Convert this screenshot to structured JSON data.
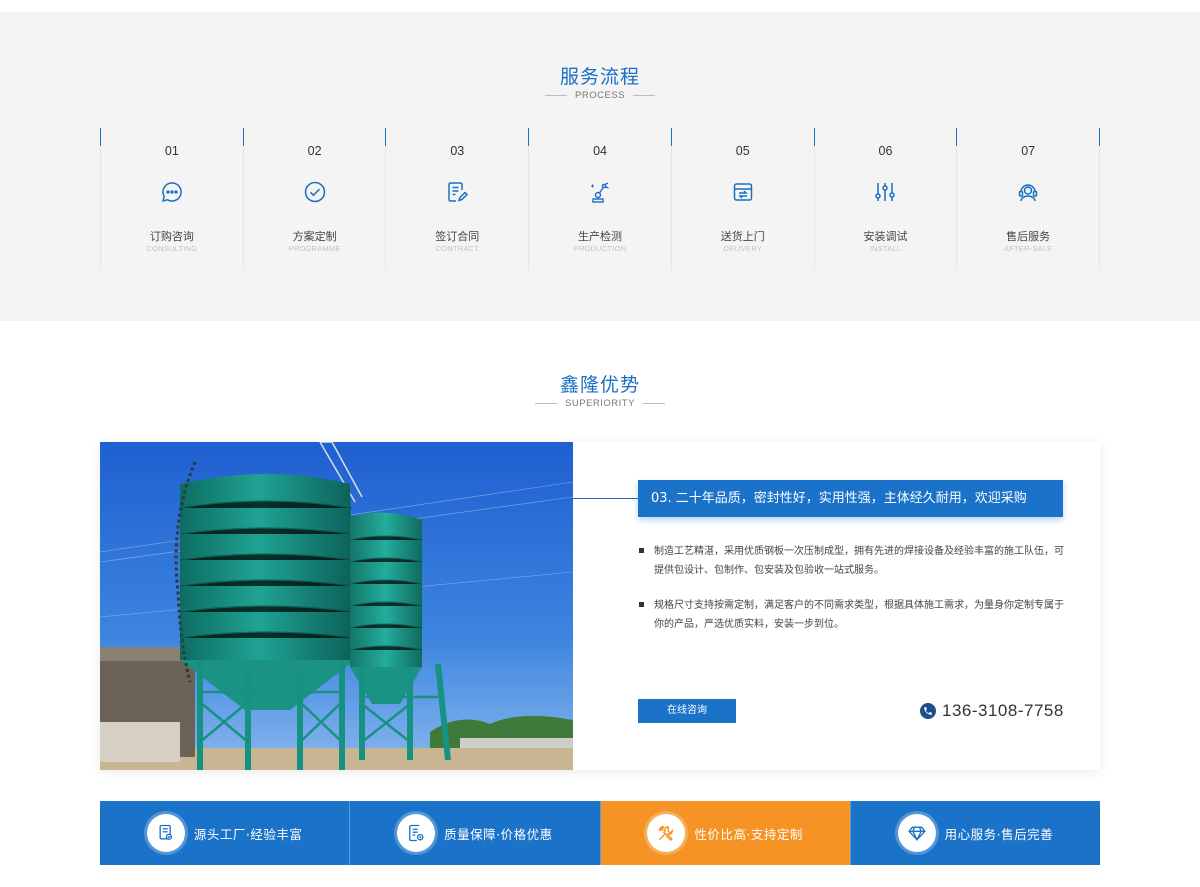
{
  "process": {
    "title": "服务流程",
    "subtitle": "PROCESS",
    "steps": [
      {
        "num": "01",
        "cn": "订购咨询",
        "en": "CONSULTING",
        "icon": "chat-bubble-icon"
      },
      {
        "num": "02",
        "cn": "方案定制",
        "en": "PROGRAMME",
        "icon": "check-circle-icon"
      },
      {
        "num": "03",
        "cn": "签订合同",
        "en": "CONTRACT",
        "icon": "contract-edit-icon"
      },
      {
        "num": "04",
        "cn": "生产检测",
        "en": "PRODUCTION",
        "icon": "robot-arm-icon"
      },
      {
        "num": "05",
        "cn": "送货上门",
        "en": "DELIVERY",
        "icon": "delivery-box-icon"
      },
      {
        "num": "06",
        "cn": "安装调试",
        "en": "INSTALL",
        "icon": "sliders-icon"
      },
      {
        "num": "07",
        "cn": "售后服务",
        "en": "AFTER-SALE",
        "icon": "headset-icon"
      }
    ]
  },
  "superiority": {
    "title": "鑫隆优势",
    "subtitle": "SUPERIORITY",
    "headline": "03. 二十年品质，密封性好，实用性强，主体经久耐用，欢迎采购",
    "bullets": [
      "制造工艺精湛，采用优质钢板一次压制成型，拥有先进的焊接设备及经验丰富的施工队伍，可提供包设计、包制作、包安装及包验收一站式服务。",
      "规格尺寸支持按需定制，满足客户的不同需求类型，根据具体施工需求，为量身你定制专属于你的产品，严选优质实料，安装一步到位。"
    ],
    "consult_label": "在线咨询",
    "phone": "136-3108-7758",
    "colors": {
      "primary": "#1a72c9",
      "accent": "#f59324"
    }
  },
  "features": [
    {
      "label": "源头工厂·经验丰富",
      "icon": "factory-badge-icon",
      "active": false
    },
    {
      "label": "质量保障·价格优惠",
      "icon": "quality-doc-icon",
      "active": false
    },
    {
      "label": "性价比高·支持定制",
      "icon": "tools-icon",
      "active": true
    },
    {
      "label": "用心服务·售后完善",
      "icon": "diamond-icon",
      "active": false
    }
  ]
}
